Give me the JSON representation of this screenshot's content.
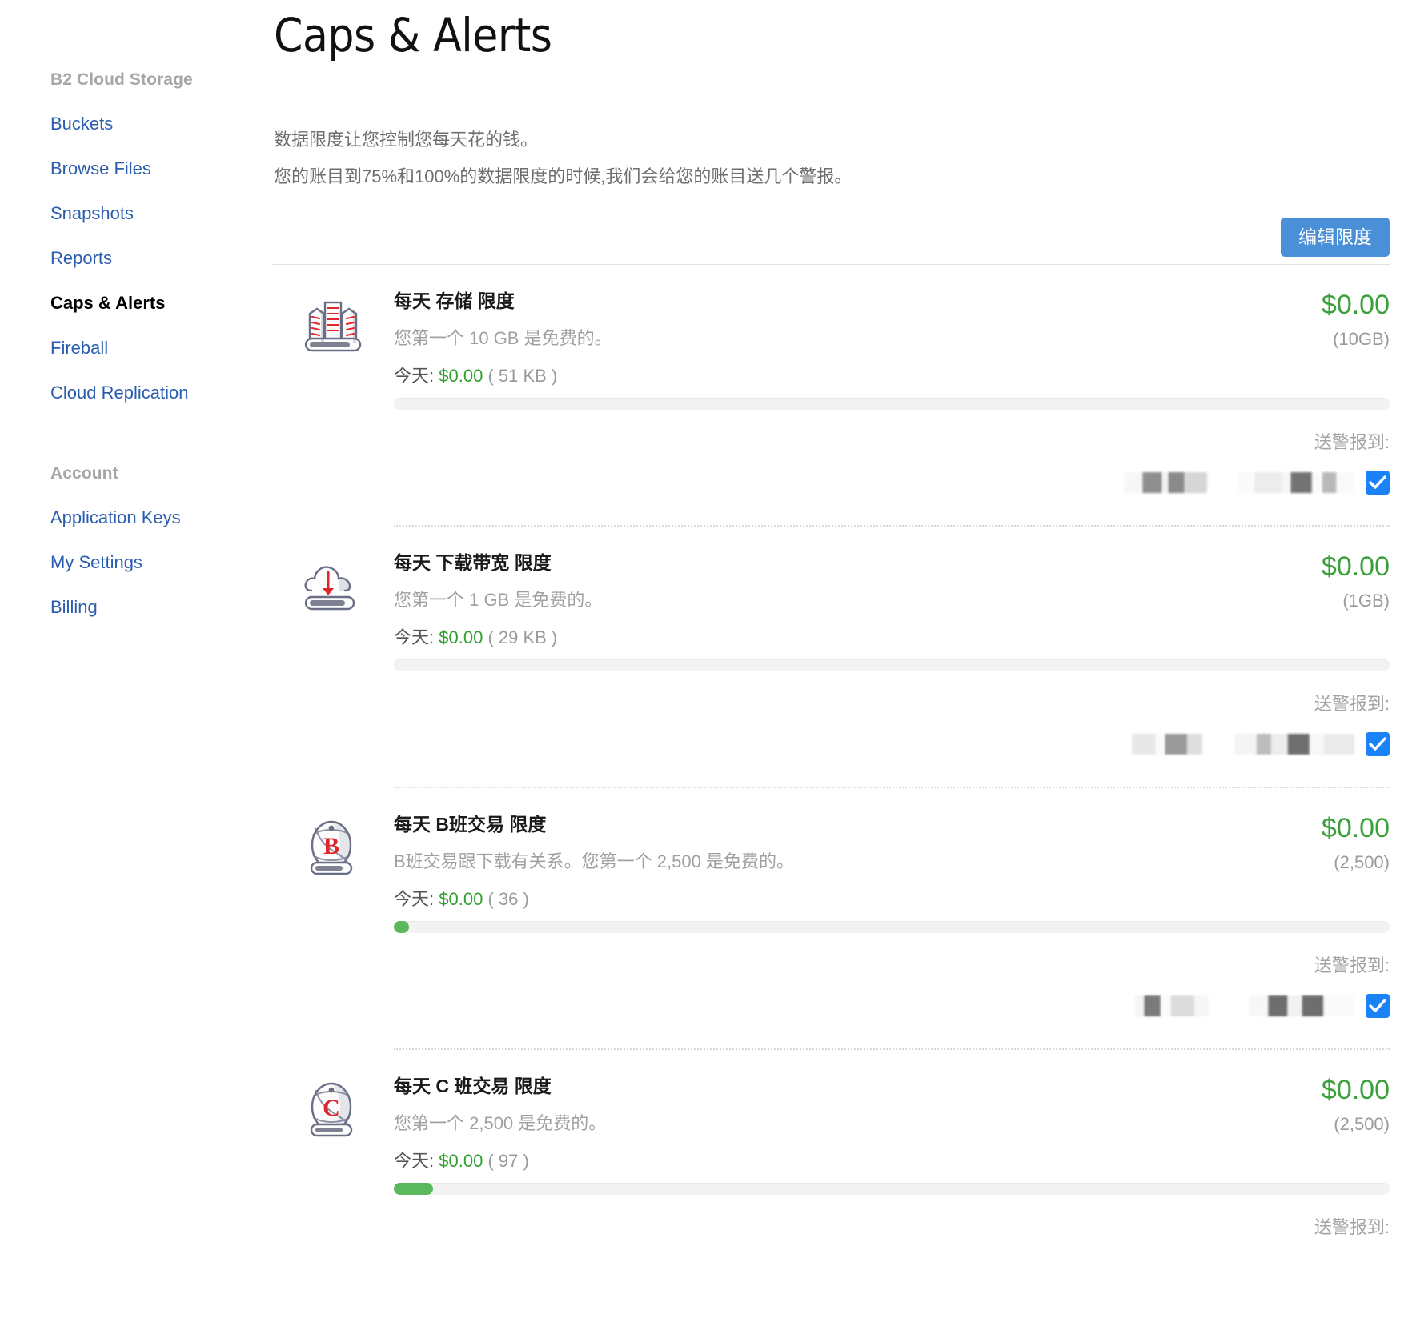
{
  "sidebar": {
    "groups": [
      {
        "title": "B2 Cloud Storage",
        "items": [
          {
            "label": "Buckets",
            "active": false
          },
          {
            "label": "Browse Files",
            "active": false
          },
          {
            "label": "Snapshots",
            "active": false
          },
          {
            "label": "Reports",
            "active": false
          },
          {
            "label": "Caps & Alerts",
            "active": true
          },
          {
            "label": "Fireball",
            "active": false
          },
          {
            "label": "Cloud Replication",
            "active": false
          }
        ]
      },
      {
        "title": "Account",
        "items": [
          {
            "label": "Application Keys",
            "active": false
          },
          {
            "label": "My Settings",
            "active": false
          },
          {
            "label": "Billing",
            "active": false
          }
        ]
      }
    ]
  },
  "header": {
    "title": "Caps & Alerts",
    "intro_line_1": "数据限度让您控制您每天花的钱。",
    "intro_line_2": "您的账目到75%和100%的数据限度的时候,我们会给您的账目送几个警报。",
    "edit_button": "编辑限度"
  },
  "labels": {
    "today_prefix": "今天:",
    "alert_to": "送警报到:"
  },
  "colors": {
    "accent_blue": "#4a90d9",
    "link_blue": "#2a5db0",
    "money_green": "#3aa03a",
    "progress_green": "#5cb85c",
    "checkbox_blue": "#1a82f7",
    "muted_gray": "#a0a0a0"
  },
  "caps": [
    {
      "icon": "storage-buildings-icon",
      "title": "每天 存储 限度",
      "description": "您第一个 10 GB 是免费的。",
      "today_amount": "$0.00",
      "today_usage": "( 51 KB )",
      "cost": "$0.00",
      "limit": "(10GB)",
      "progress_percent": 0,
      "alert_checked": true
    },
    {
      "icon": "cloud-download-icon",
      "title": "每天 下载带宽 限度",
      "description": "您第一个 1 GB 是免费的。",
      "today_amount": "$0.00",
      "today_usage": "( 29 KB )",
      "cost": "$0.00",
      "limit": "(1GB)",
      "progress_percent": 0,
      "alert_checked": true
    },
    {
      "icon": "class-b-transactions-icon",
      "title": "每天 B班交易 限度",
      "description": "B班交易跟下载有关系。您第一个 2,500 是免费的。",
      "today_amount": "$0.00",
      "today_usage": "( 36 )",
      "cost": "$0.00",
      "limit": "(2,500)",
      "progress_percent": 1.5,
      "alert_checked": true
    },
    {
      "icon": "class-c-transactions-icon",
      "title": "每天 C 班交易 限度",
      "description": "您第一个 2,500 是免费的。",
      "today_amount": "$0.00",
      "today_usage": "( 97 )",
      "cost": "$0.00",
      "limit": "(2,500)",
      "progress_percent": 3.9,
      "alert_checked": true
    }
  ]
}
